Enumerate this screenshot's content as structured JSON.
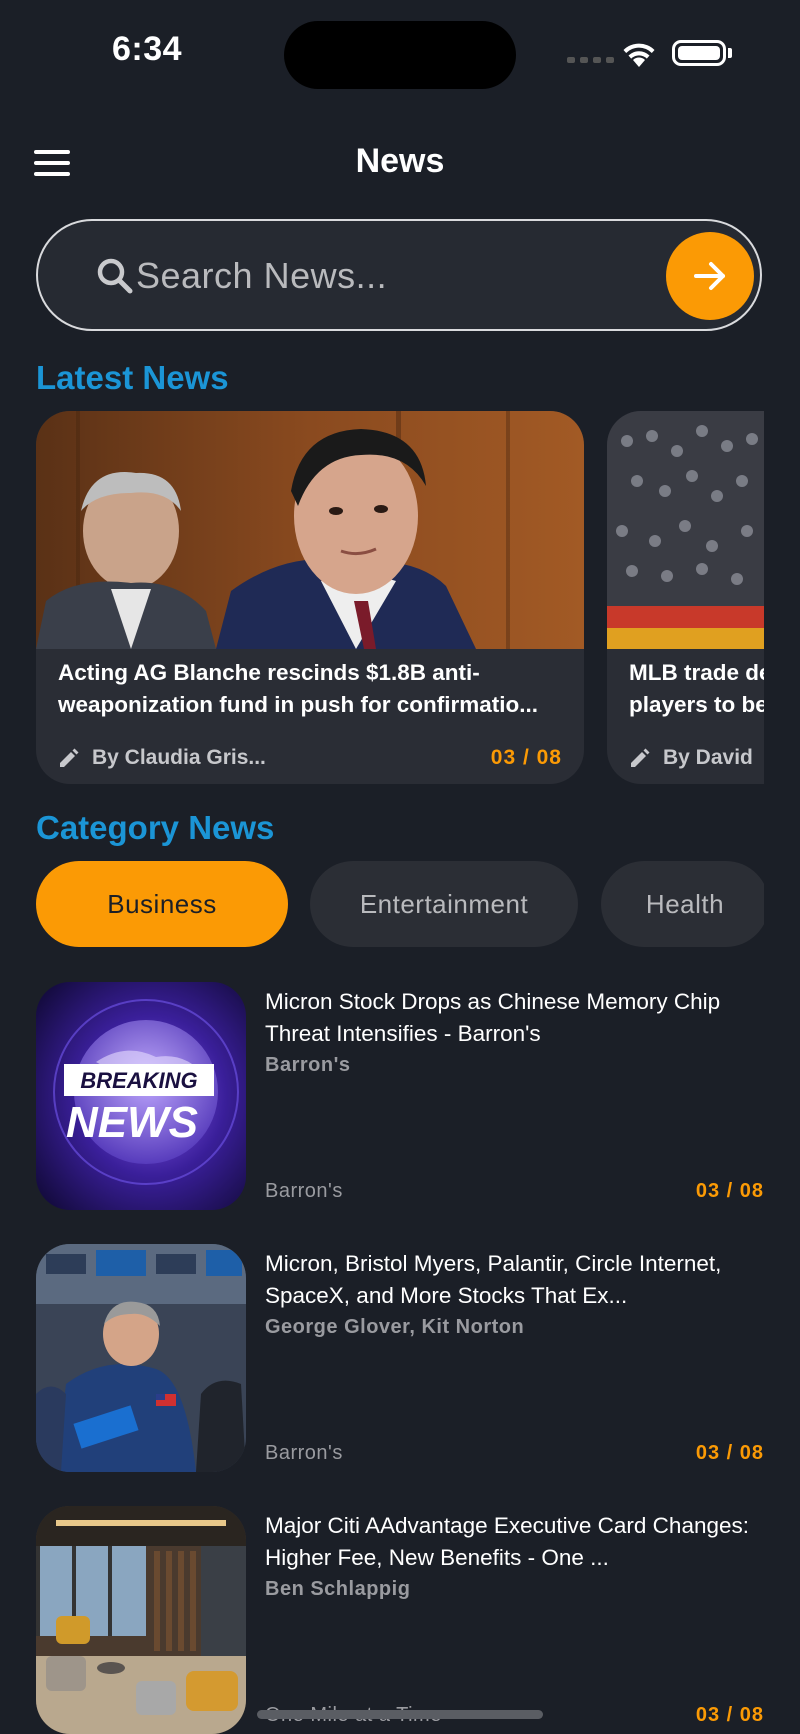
{
  "status_bar": {
    "time": "6:34"
  },
  "header": {
    "title": "News",
    "menu_icon": "hamburger-menu-icon"
  },
  "search": {
    "placeholder": "Search News...",
    "value": "",
    "icon": "search-icon",
    "submit_icon": "arrow-right-icon",
    "accent": "#fb9a05"
  },
  "latest": {
    "title": "Latest News",
    "cards": [
      {
        "title": "Acting AG Blanche rescinds $1.8B anti-weaponization fund in push for confirmatio...",
        "author": "By Claudia Gris...",
        "date": "03 / 08"
      },
      {
        "title": "MLB trade deadline: players to be dealt MLB",
        "author": "By David",
        "date": ""
      }
    ]
  },
  "category": {
    "title": "Category News",
    "chips": [
      {
        "label": "Business",
        "active": true
      },
      {
        "label": "Entertainment",
        "active": false
      },
      {
        "label": "Health",
        "active": false
      }
    ]
  },
  "articles": [
    {
      "title": "Micron Stock Drops as Chinese Memory Chip Threat Intensifies - Barron's",
      "author": "Barron's",
      "source": "Barron's",
      "date": "03 / 08",
      "thumb_text_1": "BREAKING",
      "thumb_text_2": "NEWS"
    },
    {
      "title": "Micron, Bristol Myers, Palantir, Circle Internet, SpaceX, and More Stocks That Ex...",
      "author": "George Glover, Kit Norton",
      "source": "Barron's",
      "date": "03 / 08"
    },
    {
      "title": "Major Citi AAdvantage Executive Card Changes: Higher Fee, New Benefits - One ...",
      "author": "Ben Schlappig",
      "source": "One Mile at a Time",
      "date": "03 / 08"
    }
  ],
  "colors": {
    "background": "#1b1f27",
    "accent": "#fb9a05",
    "section_title": "#1b95d6"
  }
}
